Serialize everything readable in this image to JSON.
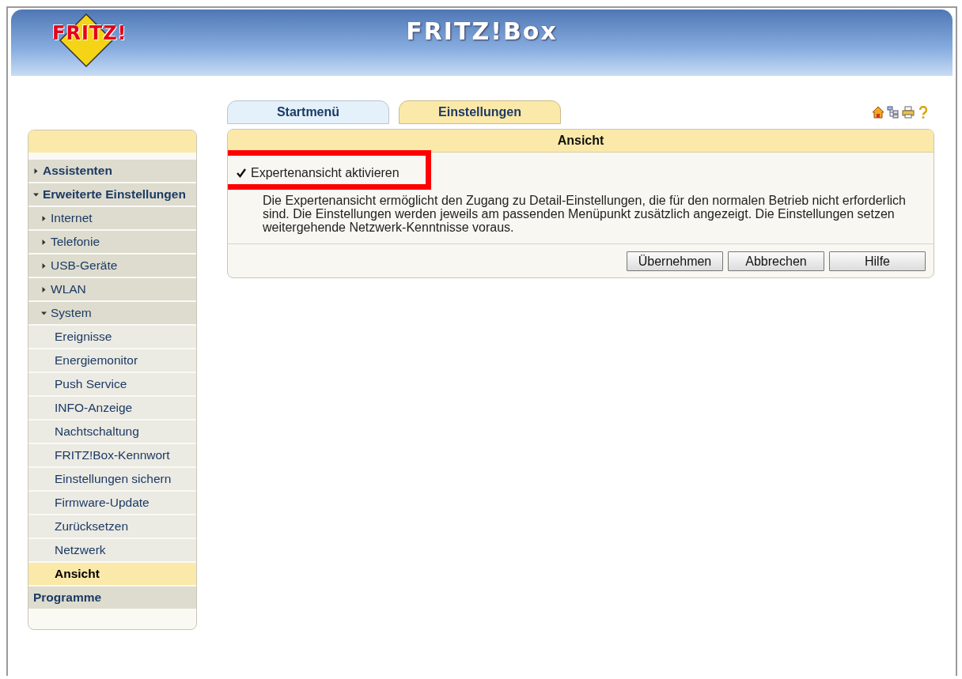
{
  "header": {
    "logo": "FRITZ!",
    "title": "FRITZ!Box"
  },
  "tabs": [
    {
      "label": "Startmenü",
      "selected": false
    },
    {
      "label": "Einstellungen",
      "selected": true
    }
  ],
  "sidebar": {
    "items": [
      {
        "label": "Assistenten",
        "expanded": false
      },
      {
        "label": "Erweiterte Einstellungen",
        "expanded": true,
        "children": [
          {
            "label": "Internet",
            "expanded": false
          },
          {
            "label": "Telefonie",
            "expanded": false
          },
          {
            "label": "USB-Geräte",
            "expanded": false
          },
          {
            "label": "WLAN",
            "expanded": false
          },
          {
            "label": "System",
            "expanded": true,
            "children": [
              {
                "label": "Ereignisse",
                "selected": false
              },
              {
                "label": "Energiemonitor",
                "selected": false
              },
              {
                "label": "Push Service",
                "selected": false
              },
              {
                "label": "INFO-Anzeige",
                "selected": false
              },
              {
                "label": "Nachtschaltung",
                "selected": false
              },
              {
                "label": "FRITZ!Box-Kennwort",
                "selected": false
              },
              {
                "label": "Einstellungen sichern",
                "selected": false
              },
              {
                "label": "Firmware-Update",
                "selected": false
              },
              {
                "label": "Zurücksetzen",
                "selected": false
              },
              {
                "label": "Netzwerk",
                "selected": false
              },
              {
                "label": "Ansicht",
                "selected": true
              }
            ]
          }
        ]
      },
      {
        "label": "Programme"
      }
    ]
  },
  "panel": {
    "title": "Ansicht",
    "option": {
      "label": "Expertenansicht aktivieren",
      "checked": true,
      "highlighted": true
    },
    "description": "Die Expertenansicht ermöglicht den Zugang zu Detail-Einstellungen, die für den normalen Betrieb nicht erforderlich sind. Die Einstellungen werden jeweils am passenden Menüpunkt zusätzlich angezeigt. Die Einstellungen setzen weitergehende Netzwerk-Kenntnisse voraus.",
    "buttons": [
      "Übernehmen",
      "Abbrechen",
      "Hilfe"
    ]
  }
}
